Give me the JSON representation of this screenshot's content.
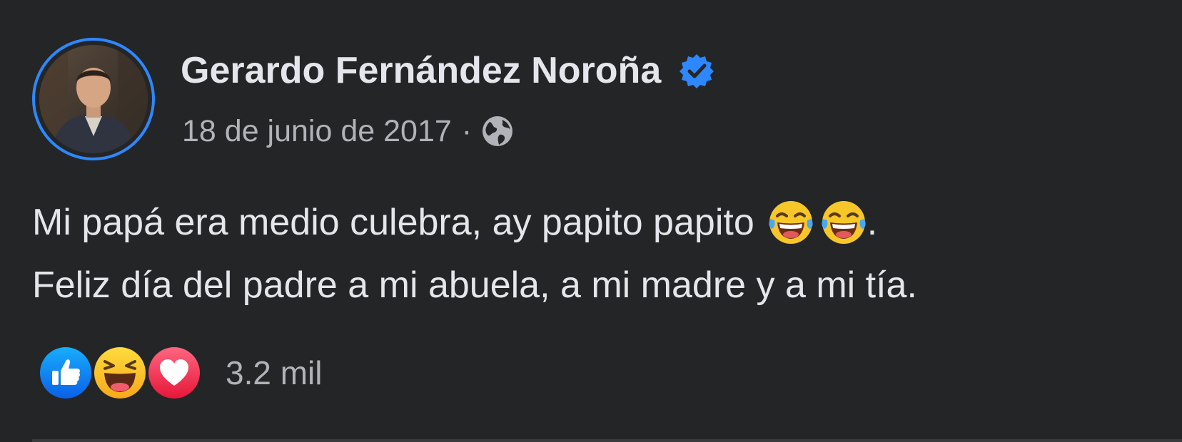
{
  "post": {
    "author": "Gerardo Fernández Noroña",
    "verified": true,
    "date": "18 de junio de 2017",
    "separator": "·",
    "audience_icon": "globe-icon",
    "text_line1": "Mi papá era medio culebra, ay papito papito",
    "text_line1_end": ".",
    "text_line2": "Feliz día del padre a mi abuela, a mi madre y a mi tía.",
    "inline_emojis": [
      "laughing-tears-emoji",
      "laughing-tears-emoji"
    ],
    "reactions": {
      "icons": [
        "like-icon",
        "haha-icon",
        "love-icon"
      ],
      "count": "3.2 mil"
    }
  },
  "colors": {
    "background": "#242526",
    "primary_text": "#e4e6eb",
    "secondary_text": "#b0b3b8",
    "accent": "#2d88ff",
    "like": "#1877f2",
    "love": "#f33e58",
    "haha": "#f7b125"
  }
}
